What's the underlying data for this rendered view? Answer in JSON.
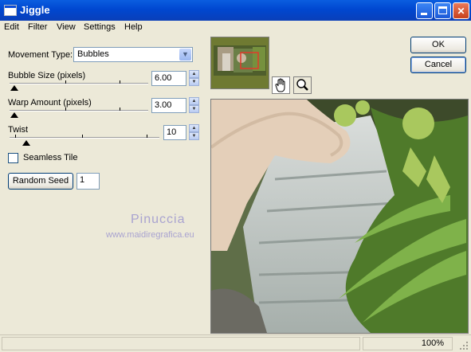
{
  "window": {
    "title": "Jiggle"
  },
  "menu": [
    "Edit",
    "Filter",
    "View",
    "Settings",
    "Help"
  ],
  "settings": {
    "movement_type_label": "Movement Type:",
    "movement_type_value": "Bubbles",
    "bubble_size_label": "Bubble Size (pixels)",
    "bubble_size_value": "6.00",
    "warp_amount_label": "Warp Amount (pixels)",
    "warp_amount_value": "3.00",
    "twist_label": "Twist",
    "twist_value": "10",
    "seamless_tile_label": "Seamless Tile",
    "seamless_tile_checked": false,
    "random_seed_button": "Random Seed",
    "random_seed_value": "1"
  },
  "buttons": {
    "ok": "OK",
    "cancel": "Cancel"
  },
  "watermark": {
    "name": "Pinuccia",
    "url": "www.maidiregrafica.eu"
  },
  "status": {
    "zoom": "100%"
  },
  "colors": {
    "titlebar": "#0a4fd8",
    "window_bg": "#ece9d8",
    "button_border": "#003c74"
  },
  "icons": [
    "hand-icon",
    "zoom-icon",
    "chevron-down-icon",
    "minimize-icon",
    "maximize-icon",
    "close-icon"
  ]
}
